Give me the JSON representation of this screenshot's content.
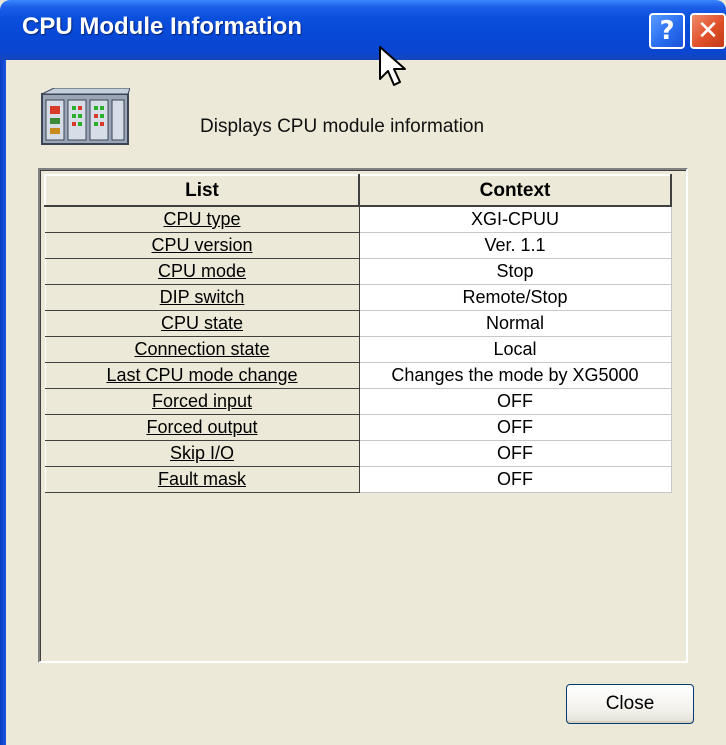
{
  "window": {
    "title": "CPU Module Information",
    "help_label": "?",
    "close_label": "✕"
  },
  "description": "Displays CPU module information",
  "table": {
    "headers": [
      "List",
      "Context"
    ],
    "rows": [
      {
        "list": "CPU type",
        "context": "XGI-CPUU"
      },
      {
        "list": "CPU version",
        "context": "Ver. 1.1"
      },
      {
        "list": "CPU mode",
        "context": "Stop"
      },
      {
        "list": "DIP switch",
        "context": "Remote/Stop"
      },
      {
        "list": "CPU state",
        "context": "Normal"
      },
      {
        "list": "Connection state",
        "context": "Local"
      },
      {
        "list": "Last CPU mode change",
        "context": "Changes the mode by XG5000"
      },
      {
        "list": "Forced input",
        "context": "OFF"
      },
      {
        "list": "Forced output",
        "context": "OFF"
      },
      {
        "list": "Skip I/O",
        "context": "OFF"
      },
      {
        "list": "Fault mask",
        "context": "OFF"
      }
    ]
  },
  "buttons": {
    "close": "Close"
  },
  "icons": {
    "app": "plc-rack-icon",
    "cursor": "mouse-pointer-icon"
  },
  "colors": {
    "titlebar": "#0a4fdc",
    "dialog_bg": "#ece9d8",
    "close_button_red": "#e0502a"
  }
}
